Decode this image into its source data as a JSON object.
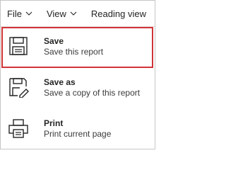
{
  "menubar": {
    "file_label": "File",
    "view_label": "View",
    "reading_view_label": "Reading view"
  },
  "dropdown": {
    "items": [
      {
        "title": "Save",
        "description": "Save this report",
        "icon": "save-icon",
        "selected": true
      },
      {
        "title": "Save as",
        "description": "Save a copy of this report",
        "icon": "save-as-icon",
        "selected": false
      },
      {
        "title": "Print",
        "description": "Print current page",
        "icon": "print-icon",
        "selected": false
      }
    ]
  },
  "colors": {
    "highlight_border": "#d13438",
    "text": "#252423",
    "icon_stroke": "#252423"
  }
}
